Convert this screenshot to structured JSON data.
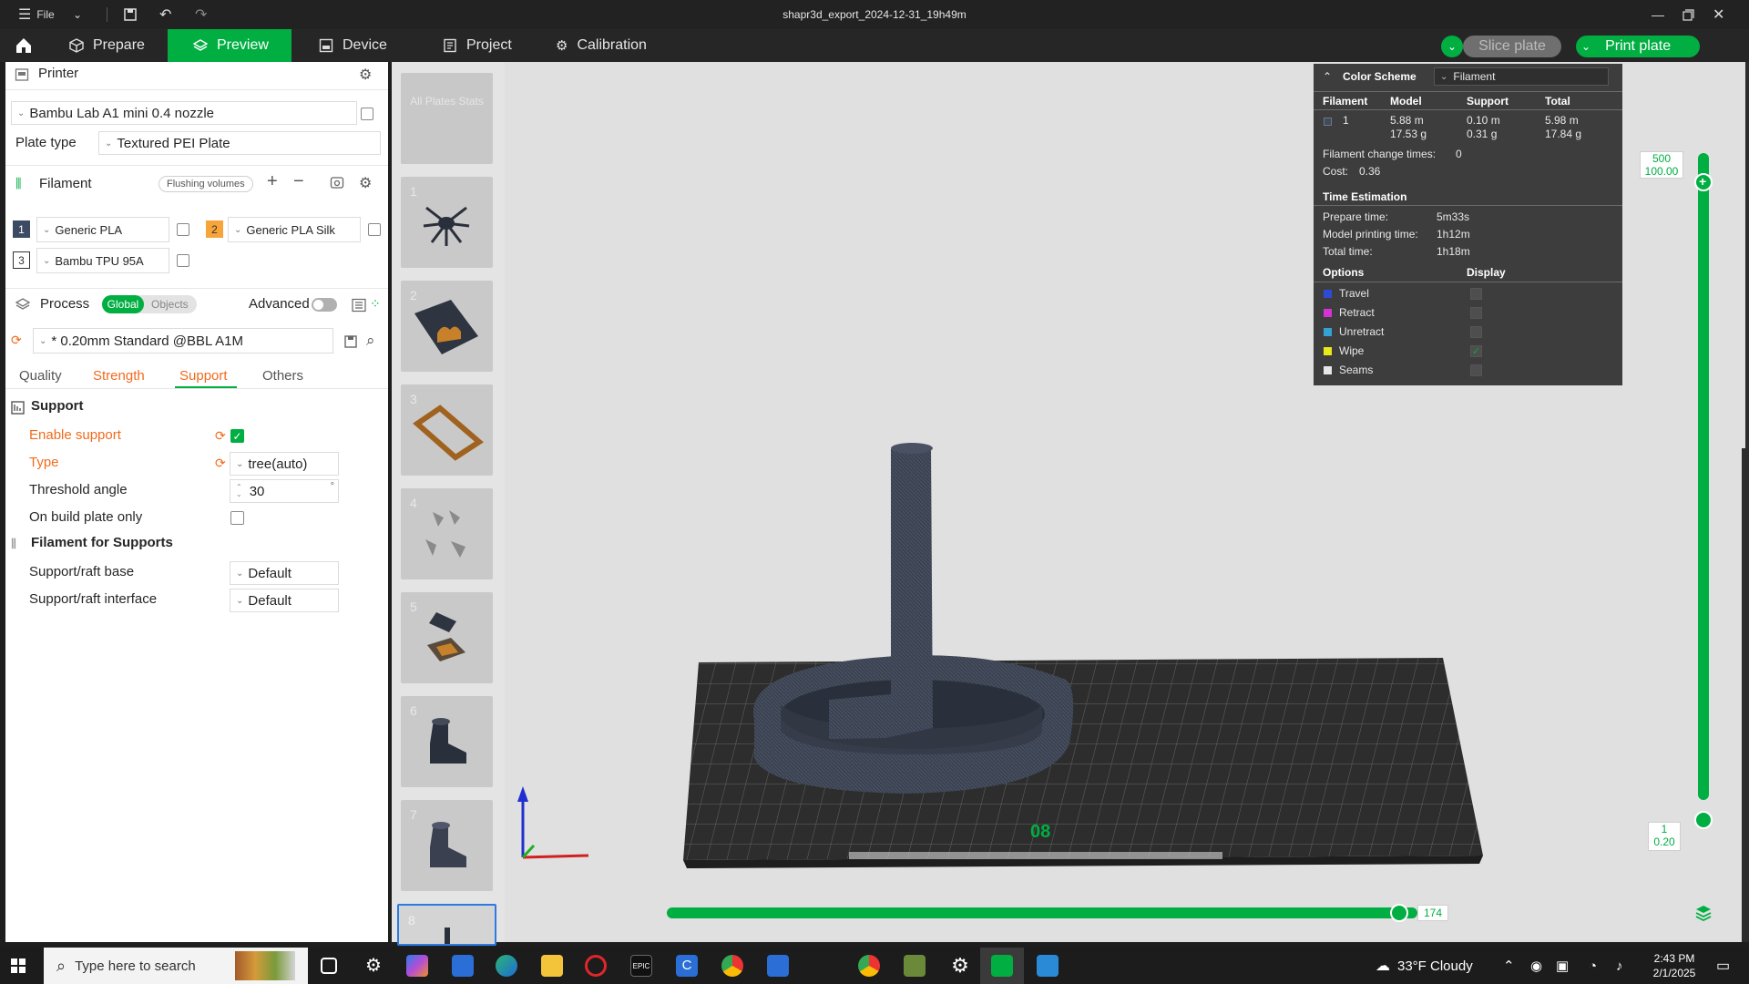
{
  "window": {
    "file_menu_label": "File",
    "title": "shapr3d_export_2024-12-31_19h49m"
  },
  "nav": {
    "tabs": [
      {
        "label": "Prepare"
      },
      {
        "label": "Preview"
      },
      {
        "label": "Device"
      },
      {
        "label": "Project"
      },
      {
        "label": "Calibration"
      }
    ],
    "slice_label": "Slice plate",
    "print_label": "Print plate"
  },
  "printer": {
    "section_title": "Printer",
    "selected": "Bambu Lab A1 mini 0.4 nozzle",
    "plate_type_label": "Plate type",
    "plate_type": "Textured PEI Plate"
  },
  "filament": {
    "section_title": "Filament",
    "flushing_label": "Flushing volumes",
    "items": [
      {
        "num": "1",
        "name": "Generic PLA",
        "color": "#3d4a63"
      },
      {
        "num": "2",
        "name": "Generic PLA Silk",
        "color": "#f7a43a"
      },
      {
        "num": "3",
        "name": "Bambu TPU 95A",
        "color": "#ffffff"
      }
    ]
  },
  "process": {
    "section_title": "Process",
    "global_label": "Global",
    "objects_label": "Objects",
    "advanced_label": "Advanced",
    "preset": "* 0.20mm Standard @BBL A1M",
    "tabs": [
      "Quality",
      "Strength",
      "Support",
      "Others"
    ],
    "support": {
      "group_title": "Support",
      "enable_label": "Enable support",
      "type_label": "Type",
      "type_value": "tree(auto)",
      "threshold_label": "Threshold angle",
      "threshold_value": "30",
      "threshold_unit": "°",
      "build_plate_label": "On build plate only",
      "filament_group_title": "Filament for Supports",
      "base_label": "Support/raft base",
      "base_value": "Default",
      "interface_label": "Support/raft interface",
      "interface_value": "Default"
    }
  },
  "plates": {
    "all_stats_label": "All Plates Stats",
    "numbers": [
      "1",
      "2",
      "3",
      "4",
      "5",
      "6",
      "7",
      "8"
    ]
  },
  "stats": {
    "color_scheme_label": "Color Scheme",
    "color_scheme_value": "Filament",
    "headers": [
      "Filament",
      "Model",
      "Support",
      "Total"
    ],
    "row": {
      "filament": "1",
      "model_m": "5.88 m",
      "model_g": "17.53 g",
      "support_m": "0.10 m",
      "support_g": "0.31 g",
      "total_m": "5.98 m",
      "total_g": "17.84 g"
    },
    "change_times_label": "Filament change times:",
    "change_times_value": "0",
    "cost_label": "Cost:",
    "cost_value": "0.36",
    "time_title": "Time Estimation",
    "prepare_label": "Prepare time:",
    "prepare_value": "5m33s",
    "model_time_label": "Model printing time:",
    "model_time_value": "1h12m",
    "total_time_label": "Total time:",
    "total_time_value": "1h18m",
    "options_label": "Options",
    "display_label": "Display",
    "options": [
      {
        "name": "Travel",
        "color": "#2e4bd6",
        "display": false
      },
      {
        "name": "Retract",
        "color": "#d633d6",
        "display": false
      },
      {
        "name": "Unretract",
        "color": "#33a3d6",
        "display": false
      },
      {
        "name": "Wipe",
        "color": "#e8e81a",
        "display": true
      },
      {
        "name": "Seams",
        "color": "#e6e6e6",
        "display": false
      }
    ]
  },
  "layers": {
    "top_layer": "500",
    "top_height": "100.00",
    "bottom_layer": "1",
    "bottom_height": "0.20",
    "horizontal_value": "174"
  },
  "plate_label": "08",
  "taskbar": {
    "search_placeholder": "Type here to search",
    "weather": "33°F  Cloudy",
    "time": "2:43 PM",
    "date": "2/1/2025"
  },
  "colors": {
    "accent": "#00ae42",
    "orange": "#f26b1d"
  }
}
